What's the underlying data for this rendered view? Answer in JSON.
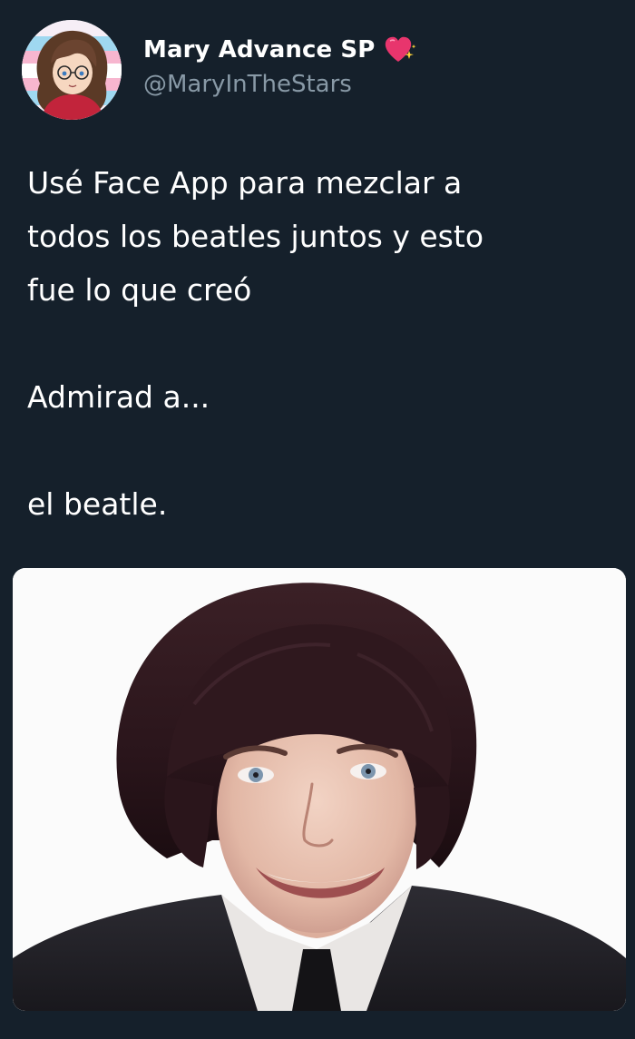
{
  "user": {
    "display_name": "Mary Advance SP",
    "handle": "@MaryInTheStars",
    "name_emoji": "sparkling-heart-icon"
  },
  "tweet": {
    "lines": [
      "Usé Face App para mezclar a",
      "todos los beatles juntos y esto",
      "fue lo que creó",
      "Admirad a...",
      "el beatle."
    ]
  },
  "media": {
    "type": "photo",
    "subject": "portrait-photo"
  },
  "colors": {
    "background": "#15202b",
    "text": "#ffffff",
    "secondary_text": "#8899a6",
    "heart": "#e8356d",
    "sparkle": "#ffd43b"
  }
}
